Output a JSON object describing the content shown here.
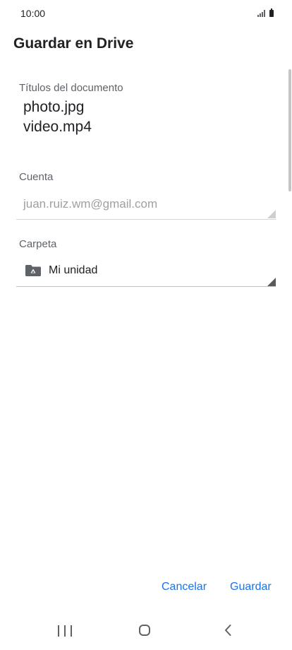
{
  "status_bar": {
    "time": "10:00",
    "signal_icon": "signal-icon",
    "battery_icon": "battery-icon"
  },
  "header": {
    "title": "Guardar en Drive"
  },
  "document_titles": {
    "label": "Títulos del documento",
    "items": [
      "photo.jpg",
      "video.mp4"
    ]
  },
  "account": {
    "label": "Cuenta",
    "value": "juan.ruiz.wm@gmail.com"
  },
  "folder": {
    "label": "Carpeta",
    "value": "Mi unidad",
    "icon": "drive-folder-icon"
  },
  "actions": {
    "cancel_label": "Cancelar",
    "save_label": "Guardar",
    "accent_color": "#1a73e8"
  },
  "nav_bar": {
    "recents_icon": "recents-icon",
    "home_icon": "home-icon",
    "back_icon": "back-icon"
  }
}
